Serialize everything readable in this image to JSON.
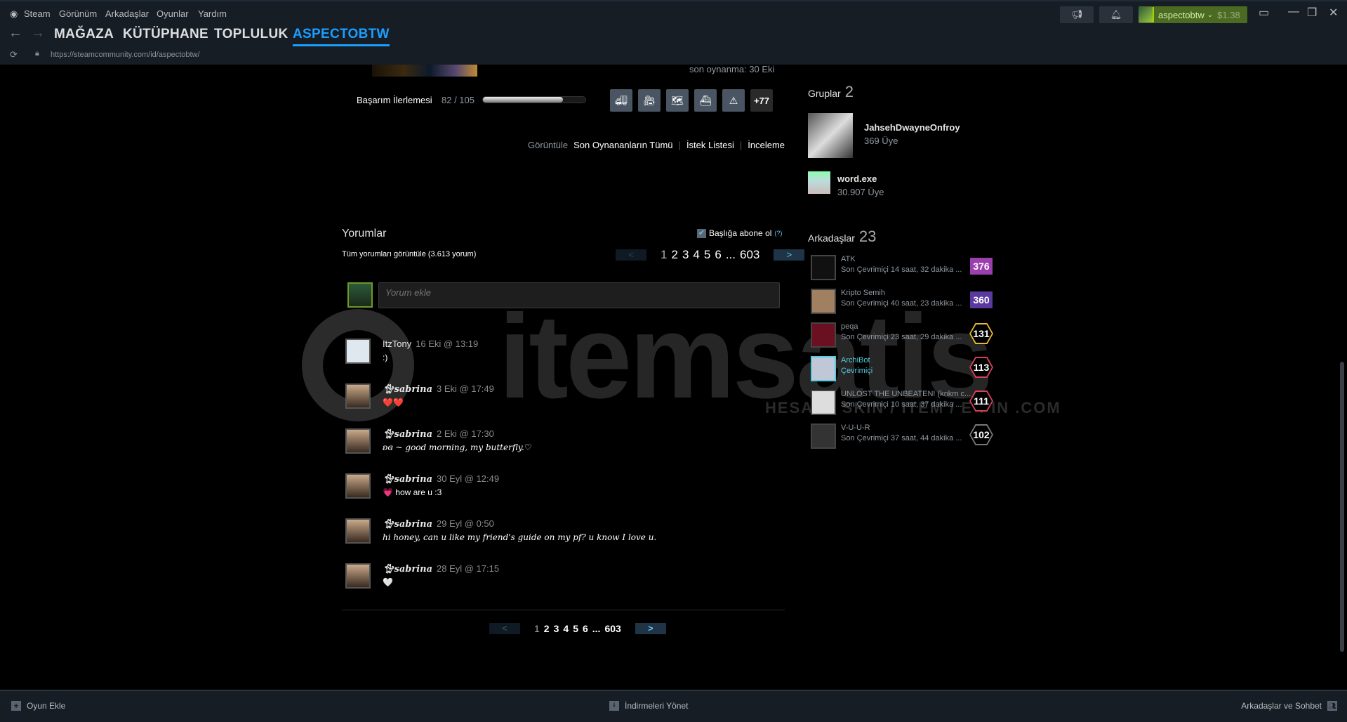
{
  "titlebar": {
    "menu": [
      "Steam",
      "Görünüm",
      "Arkadaşlar",
      "Oyunlar",
      "Yardım"
    ],
    "nav": [
      "MAĞAZA",
      "KÜTÜPHANE",
      "TOPLULUK",
      "ASPECTOBTW"
    ],
    "url": "https://steamcommunity.com/id/aspectobtw/",
    "user": {
      "name": "aspectobtw",
      "balance": "$1.38"
    }
  },
  "game": {
    "last_played": "son oynanma: 30 Eki",
    "ach_label": "Başarım İlerlemesi",
    "ach_progress": "82 / 105",
    "ach_fraction": 0.781,
    "ach_more": "+77",
    "view_label": "Görüntüle",
    "links": [
      "Son Oynananların Tümü",
      "İstek Listesi",
      "İnceleme"
    ]
  },
  "groups": {
    "title": "Gruplar",
    "count": "2",
    "items": [
      {
        "name": "JahsehDwayneOnfroy",
        "members": "369 Üye"
      },
      {
        "name": "word.exe",
        "members": "30.907 Üye"
      }
    ]
  },
  "friends": {
    "title": "Arkadaşlar",
    "count": "23",
    "items": [
      {
        "name": "ATK",
        "status": "Son Çevrimiçi 14 saat, 32 dakika ...",
        "level": "376",
        "color": "#9b3fae"
      },
      {
        "name": "Kripto Semih",
        "status": "Son Çevrimiçi 40 saat, 23 dakika ...",
        "level": "360",
        "color": "#5a3a9e"
      },
      {
        "name": "peqa",
        "status": "Son Çevrimiçi 23 saat, 29 dakika ...",
        "level": "131",
        "color": "#e6b92e"
      },
      {
        "name": "ArchiBot",
        "status": "Çevrimiçi",
        "level": "113",
        "color": "#d9415a"
      },
      {
        "name": "UNLOST THE UNBEATEN! (knkm c...",
        "status": "Son Çevrimiçi 10 saat, 37 dakika ...",
        "level": "111",
        "color": "#d9415a"
      },
      {
        "name": "V-U-U-R",
        "status": "Son Çevrimiçi 37 saat, 44 dakika ...",
        "level": "102",
        "color": "#777777"
      }
    ]
  },
  "comments": {
    "title": "Yorumlar",
    "subscribe": "Başlığa abone ol",
    "help": "(?)",
    "view_all": "Tüm yorumları görüntüle (3.613 yorum)",
    "pages": [
      "1",
      "2",
      "3",
      "4",
      "5",
      "6",
      "...",
      "603"
    ],
    "prev": "<",
    "next": ">",
    "placeholder": "Yorum ekle",
    "items": [
      {
        "author": "ItzTony",
        "date": "16 Eki @ 13:19",
        "text": ":)"
      },
      {
        "author": "sabrina",
        "date": "3 Eki @ 17:49",
        "text": "❤️❤️"
      },
      {
        "author": "sabrina",
        "date": "2 Eki @ 17:30",
        "text": "ʚɞ ~ good morning, my butterfly.♡"
      },
      {
        "author": "sabrina",
        "date": "30 Eyl @ 12:49",
        "text": "💗 how are u :3"
      },
      {
        "author": "sabrina",
        "date": "29 Eyl @ 0:50",
        "text": "hi honey, can u like my friend's guide on my pf? u know I love u."
      },
      {
        "author": "sabrina",
        "date": "28 Eyl @ 17:15",
        "text": "🤍"
      }
    ]
  },
  "watermark": {
    "text": "itemsatis",
    "sub": "HESAP / SKIN / ITEM / E-PIN .COM"
  },
  "bottombar": {
    "add_game": "Oyun Ekle",
    "downloads": "İndirmeleri Yönet",
    "friends_chat": "Arkadaşlar ve Sohbet"
  }
}
